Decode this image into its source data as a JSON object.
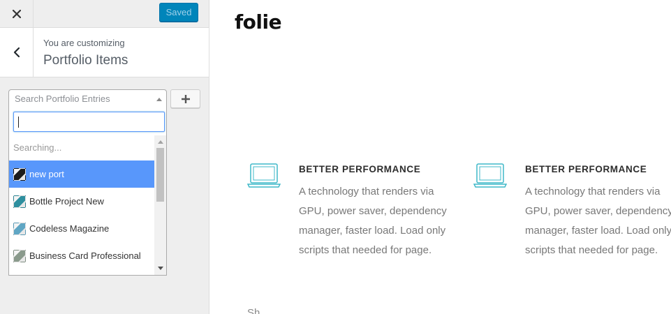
{
  "toolbar": {
    "close_icon": "close-icon",
    "saved_label": "Saved"
  },
  "section": {
    "customizing_label": "You are customizing",
    "title": "Portfolio Items",
    "back_icon": "chevron-left-icon"
  },
  "search": {
    "placeholder": "Search Portfolio Entries",
    "add_icon": "plus-icon",
    "input_value": ""
  },
  "dropdown": {
    "status": "Searching...",
    "options": [
      {
        "label": "new port",
        "highlighted": true,
        "thumb_color": "#1c1c1c"
      },
      {
        "label": "Bottle Project New",
        "highlighted": false,
        "thumb_color": "#2e8f9f"
      },
      {
        "label": "Codeless Magazine",
        "highlighted": false,
        "thumb_color": "#5fa6c4"
      },
      {
        "label": "Business Card Professional",
        "highlighted": false,
        "thumb_color": "#8a9a8c"
      }
    ]
  },
  "preview": {
    "logo": "folie",
    "features": [
      {
        "icon": "laptop-icon",
        "title": "BETTER PERFORMANCE",
        "text": "A technology that renders via GPU, power saver, dependency manager, faster load. Load only scripts that needed for page."
      },
      {
        "icon": "laptop-icon",
        "title": "BETTER PERFORMANCE",
        "text": "A technology that renders via GPU, power saver, dependency manager, faster load. Load only scripts that needed for page."
      }
    ],
    "partial_text": "Sh"
  },
  "colors": {
    "accent": "#0085ba",
    "highlight": "#5897fb",
    "icon": "#3fb8c8"
  }
}
